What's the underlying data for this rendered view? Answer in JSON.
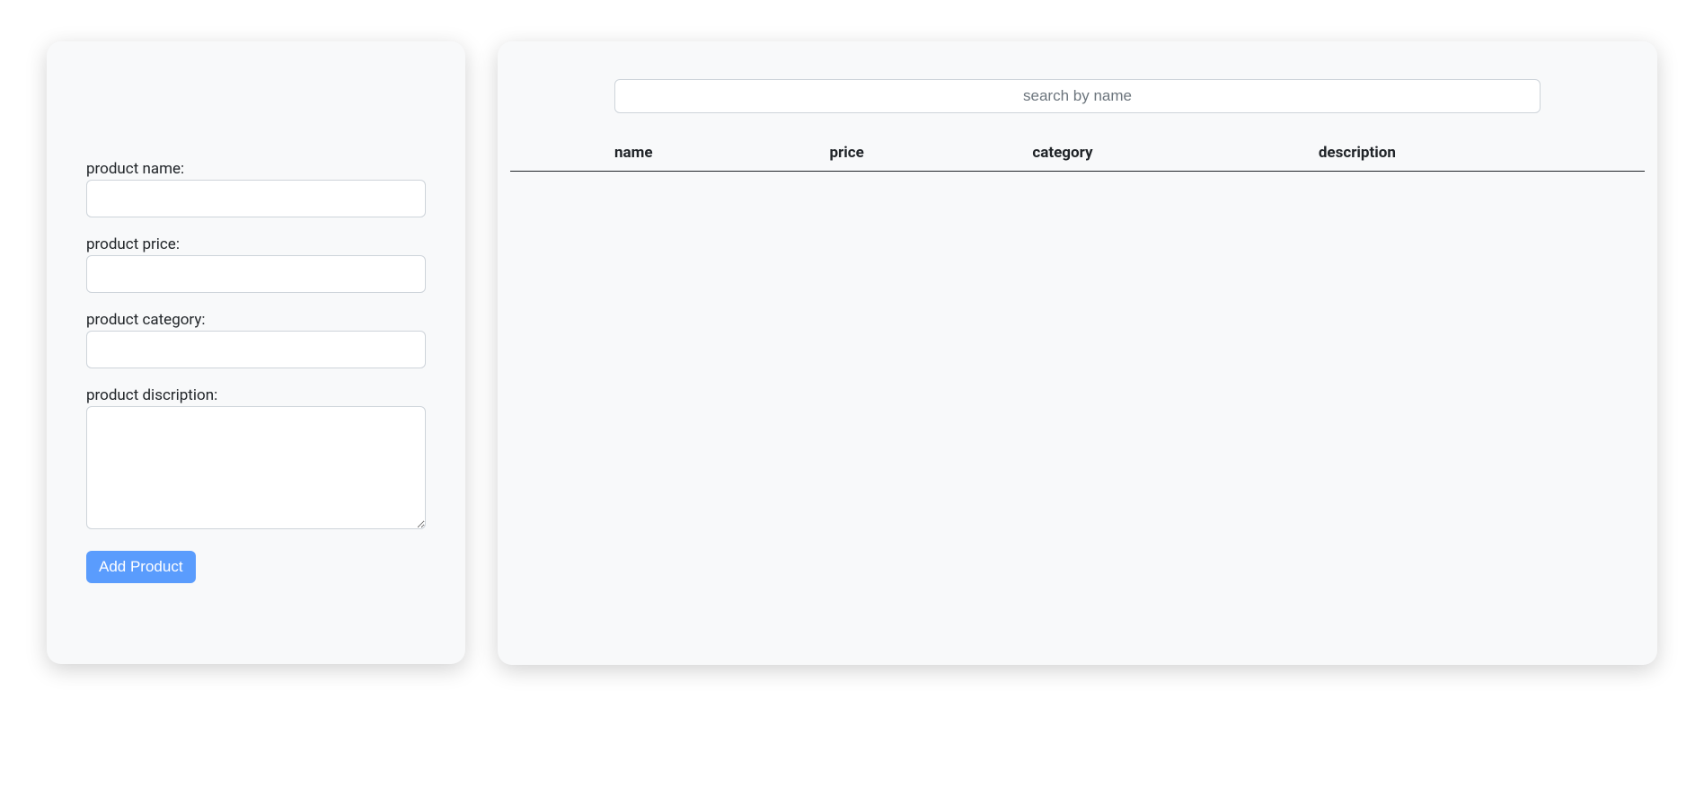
{
  "form": {
    "labels": {
      "name": "product name:",
      "price": "product price:",
      "category": "product category:",
      "description": "product discription:"
    },
    "values": {
      "name": "",
      "price": "",
      "category": "",
      "description": ""
    },
    "submit_label": "Add Product"
  },
  "search": {
    "placeholder": "search by name",
    "value": ""
  },
  "table": {
    "headers": {
      "blank": "",
      "name": "name",
      "price": "price",
      "category": "category",
      "description": "description"
    },
    "rows": []
  }
}
